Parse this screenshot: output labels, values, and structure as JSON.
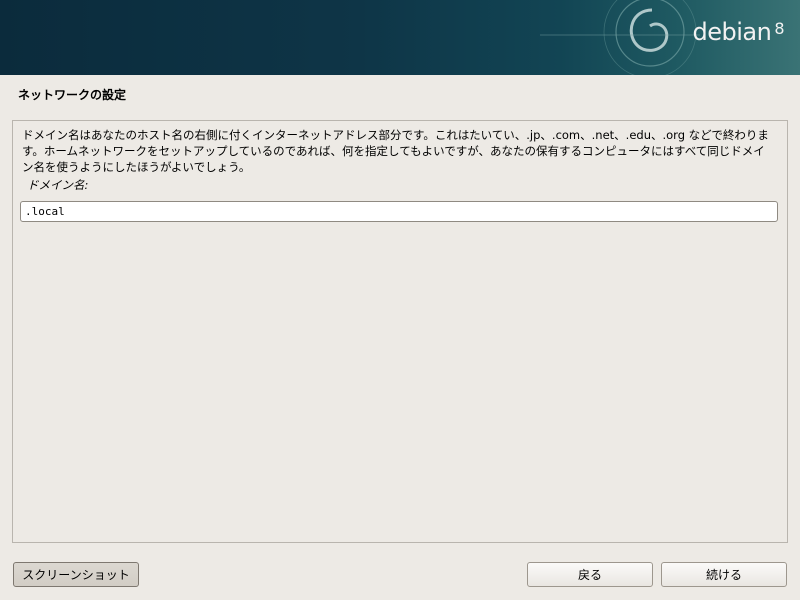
{
  "banner": {
    "brand": "debian",
    "version": "8"
  },
  "page": {
    "title": "ネットワークの設定"
  },
  "content": {
    "description": "ドメイン名はあなたのホスト名の右側に付くインターネットアドレス部分です。これはたいてい、.jp、.com、.net、.edu、.org などで終わります。ホームネットワークをセットアップしているのであれば、何を指定してもよいですが、あなたの保有するコンピュータにはすべて同じドメイン名を使うようにしたほうがよいでしょう。",
    "field_label": "ドメイン名:",
    "field_value": ".local"
  },
  "buttons": {
    "screenshot": "スクリーンショット",
    "back": "戻る",
    "continue": "続ける"
  }
}
